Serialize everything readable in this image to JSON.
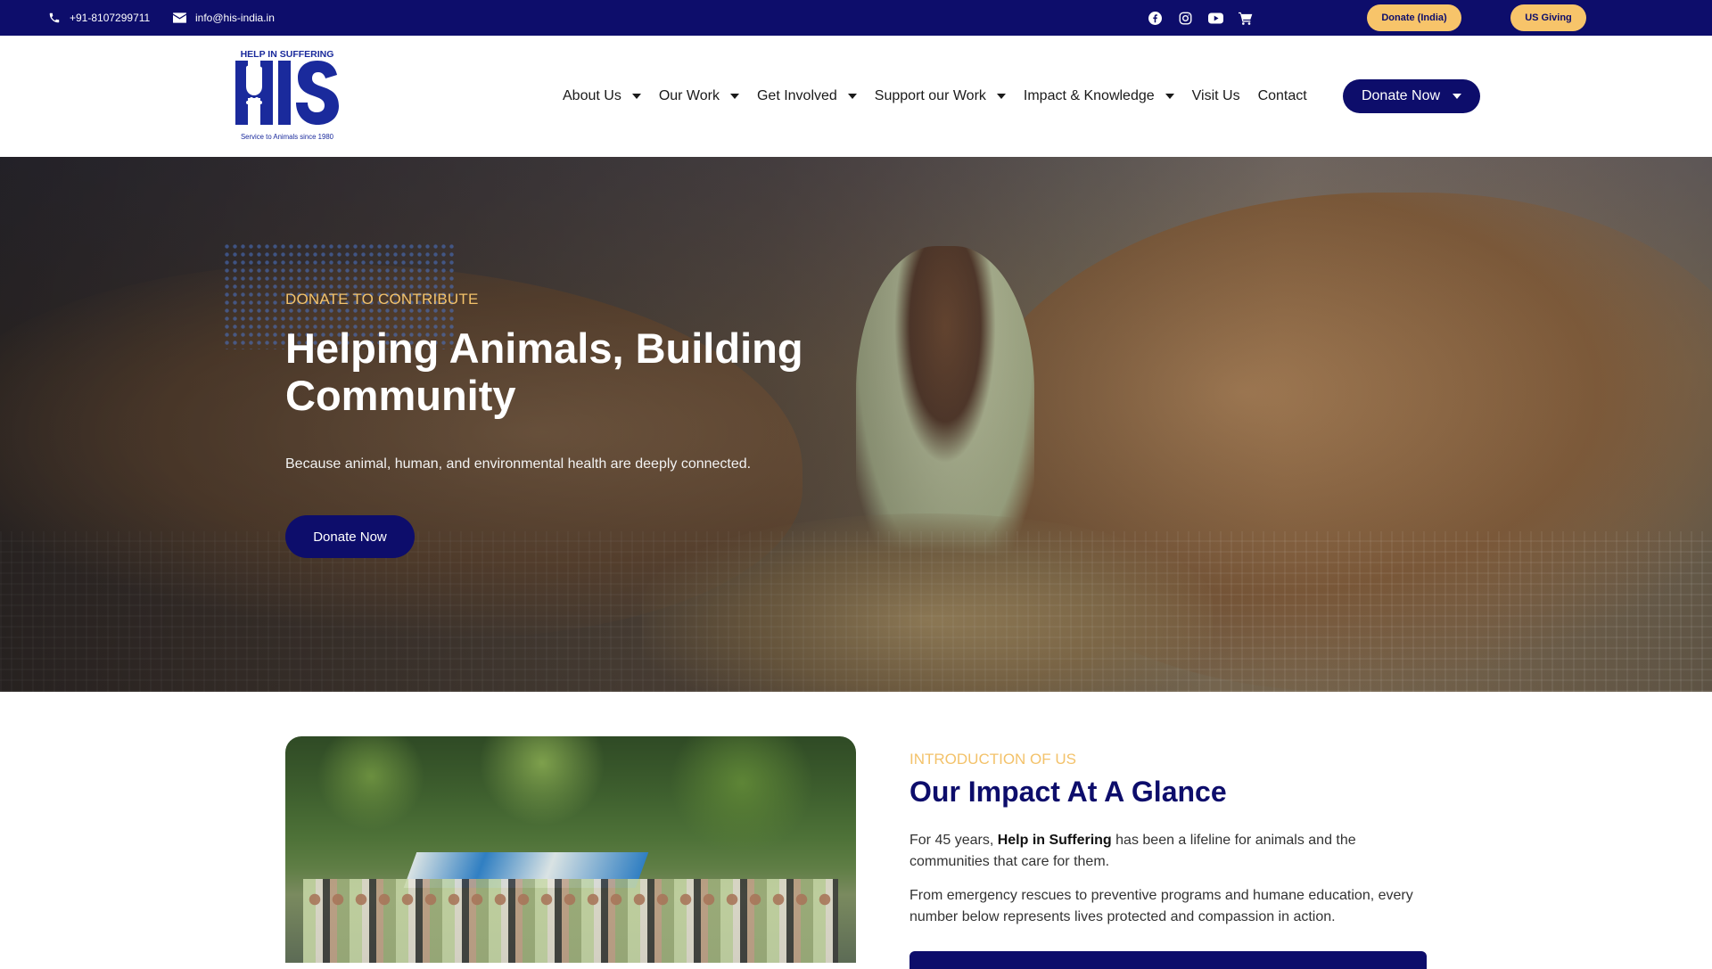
{
  "topbar": {
    "phone": "+91-8107299711",
    "email": "info@his-india.in",
    "social": [
      "facebook-icon",
      "instagram-icon",
      "youtube-icon",
      "cart-icon"
    ],
    "donate_india": "Donate (India)",
    "us_giving": "US Giving"
  },
  "logo": {
    "top_text": "HELP IN SUFFERING",
    "letters": "HIS",
    "tagline": "Service to Animals since 1980"
  },
  "nav": {
    "items": [
      {
        "label": "About Us",
        "dropdown": true
      },
      {
        "label": "Our Work",
        "dropdown": true
      },
      {
        "label": "Get Involved",
        "dropdown": true
      },
      {
        "label": "Support our Work",
        "dropdown": true
      },
      {
        "label": "Impact & Knowledge",
        "dropdown": true
      },
      {
        "label": "Visit Us",
        "dropdown": false
      },
      {
        "label": "Contact",
        "dropdown": false
      }
    ],
    "donate_button": "Donate Now"
  },
  "hero": {
    "eyebrow": "DONATE TO CONTRIBUTE",
    "title": "Helping Animals, Building Community",
    "subtitle": "Because animal, human, and environmental health are deeply connected.",
    "button": "Donate Now"
  },
  "intro": {
    "eyebrow": "INTRODUCTION OF US",
    "title": "Our Impact At A Glance",
    "p1_prefix": "For 45 years, ",
    "p1_bold": "Help in Suffering",
    "p1_suffix": " has been a lifeline for animals and the communities that care for them.",
    "p2": "From emergency rescues to preventive programs and humane education, every number below represents lives protected and compassion in action."
  },
  "colors": {
    "primary": "#0d0d6b",
    "accent": "#f7c46a",
    "eyebrow": "#f3c26a"
  }
}
